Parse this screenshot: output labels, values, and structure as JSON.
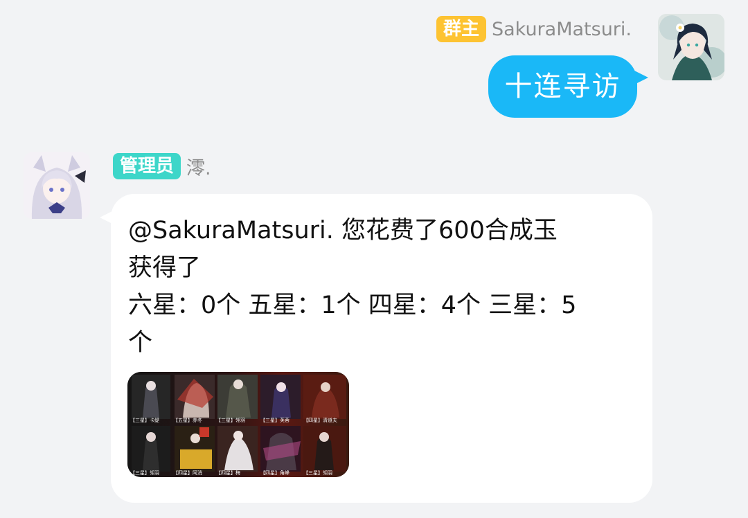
{
  "messages": [
    {
      "side": "right",
      "sender": {
        "role_badge": "群主",
        "nickname": "SakuraMatsuri."
      },
      "text": "十连寻访"
    },
    {
      "side": "left",
      "sender": {
        "role_badge": "管理员",
        "nickname": "澪."
      },
      "lines": [
        "@SakuraMatsuri. 您花费了600合成玉",
        "获得了",
        "六星：0个 五星：1个 四星：4个 三星：5",
        "个"
      ],
      "image": {
        "cards": [
          "【三星】卡缇",
          "【五星】赤冬",
          "【三星】翎羽",
          "【三星】芙蓉",
          "【四星】清道夫",
          "【三星】翎羽",
          "【四星】阿消",
          "【四星】梅",
          "【四星】角峰",
          "【三星】翎羽"
        ]
      }
    }
  ],
  "colors": {
    "background": "#f2f3f5",
    "self_bubble": "#1ab8f7",
    "other_bubble": "#ffffff",
    "owner_badge": "#fdc332",
    "admin_badge": "#3dd6c9",
    "nickname_text": "#8c8c8c"
  }
}
